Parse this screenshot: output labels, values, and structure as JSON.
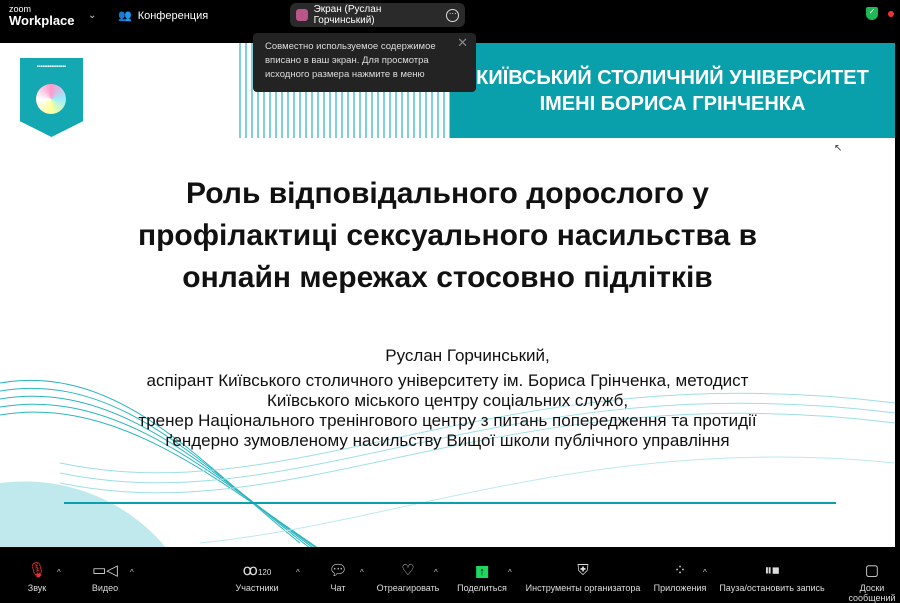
{
  "header": {
    "brand_small": "zoom",
    "brand": "Workplace",
    "meeting": "Конференция",
    "share_label": "Экран (Руслан Горчинський)"
  },
  "toast": {
    "text": "Совместно используемое содержимое вписано в ваш экран. Для просмотра исходного размера нажмите в меню"
  },
  "slide": {
    "university_line1": "КИЇВСЬКИЙ СТОЛИЧНИЙ УНІВЕРСИТЕТ",
    "university_line2": "ІМЕНІ БОРИСА ГРІНЧЕНКА",
    "title_lines": [
      "Роль відповідального дорослого у",
      "профілактиці сексуального насильства в",
      "онлайн мережах стосовно підлітків"
    ],
    "author": "Руслан Горчинський,",
    "bio_lines": [
      "аспірант Київського столичного університету ім. Бориса Грінченка, методист",
      "Київського міського центру соціальних служб,",
      "тренер Національного тренінгового центру з питань попередження та протидії",
      "ґендерно зумовленому насильству Вищої школи публічного управління"
    ]
  },
  "toolbar": {
    "audio": "Звук",
    "video": "Видео",
    "participants": "Участники",
    "participants_count": "120",
    "chat": "Чат",
    "react": "Отреагировать",
    "share": "Поделиться",
    "host_tools": "Инструменты организатора",
    "apps": "Приложения",
    "record": "Пауза/остановить запись",
    "whiteboards": "Доски сообщений"
  },
  "colors": {
    "teal": "#0aa0ab",
    "share_green": "#1ed760"
  }
}
